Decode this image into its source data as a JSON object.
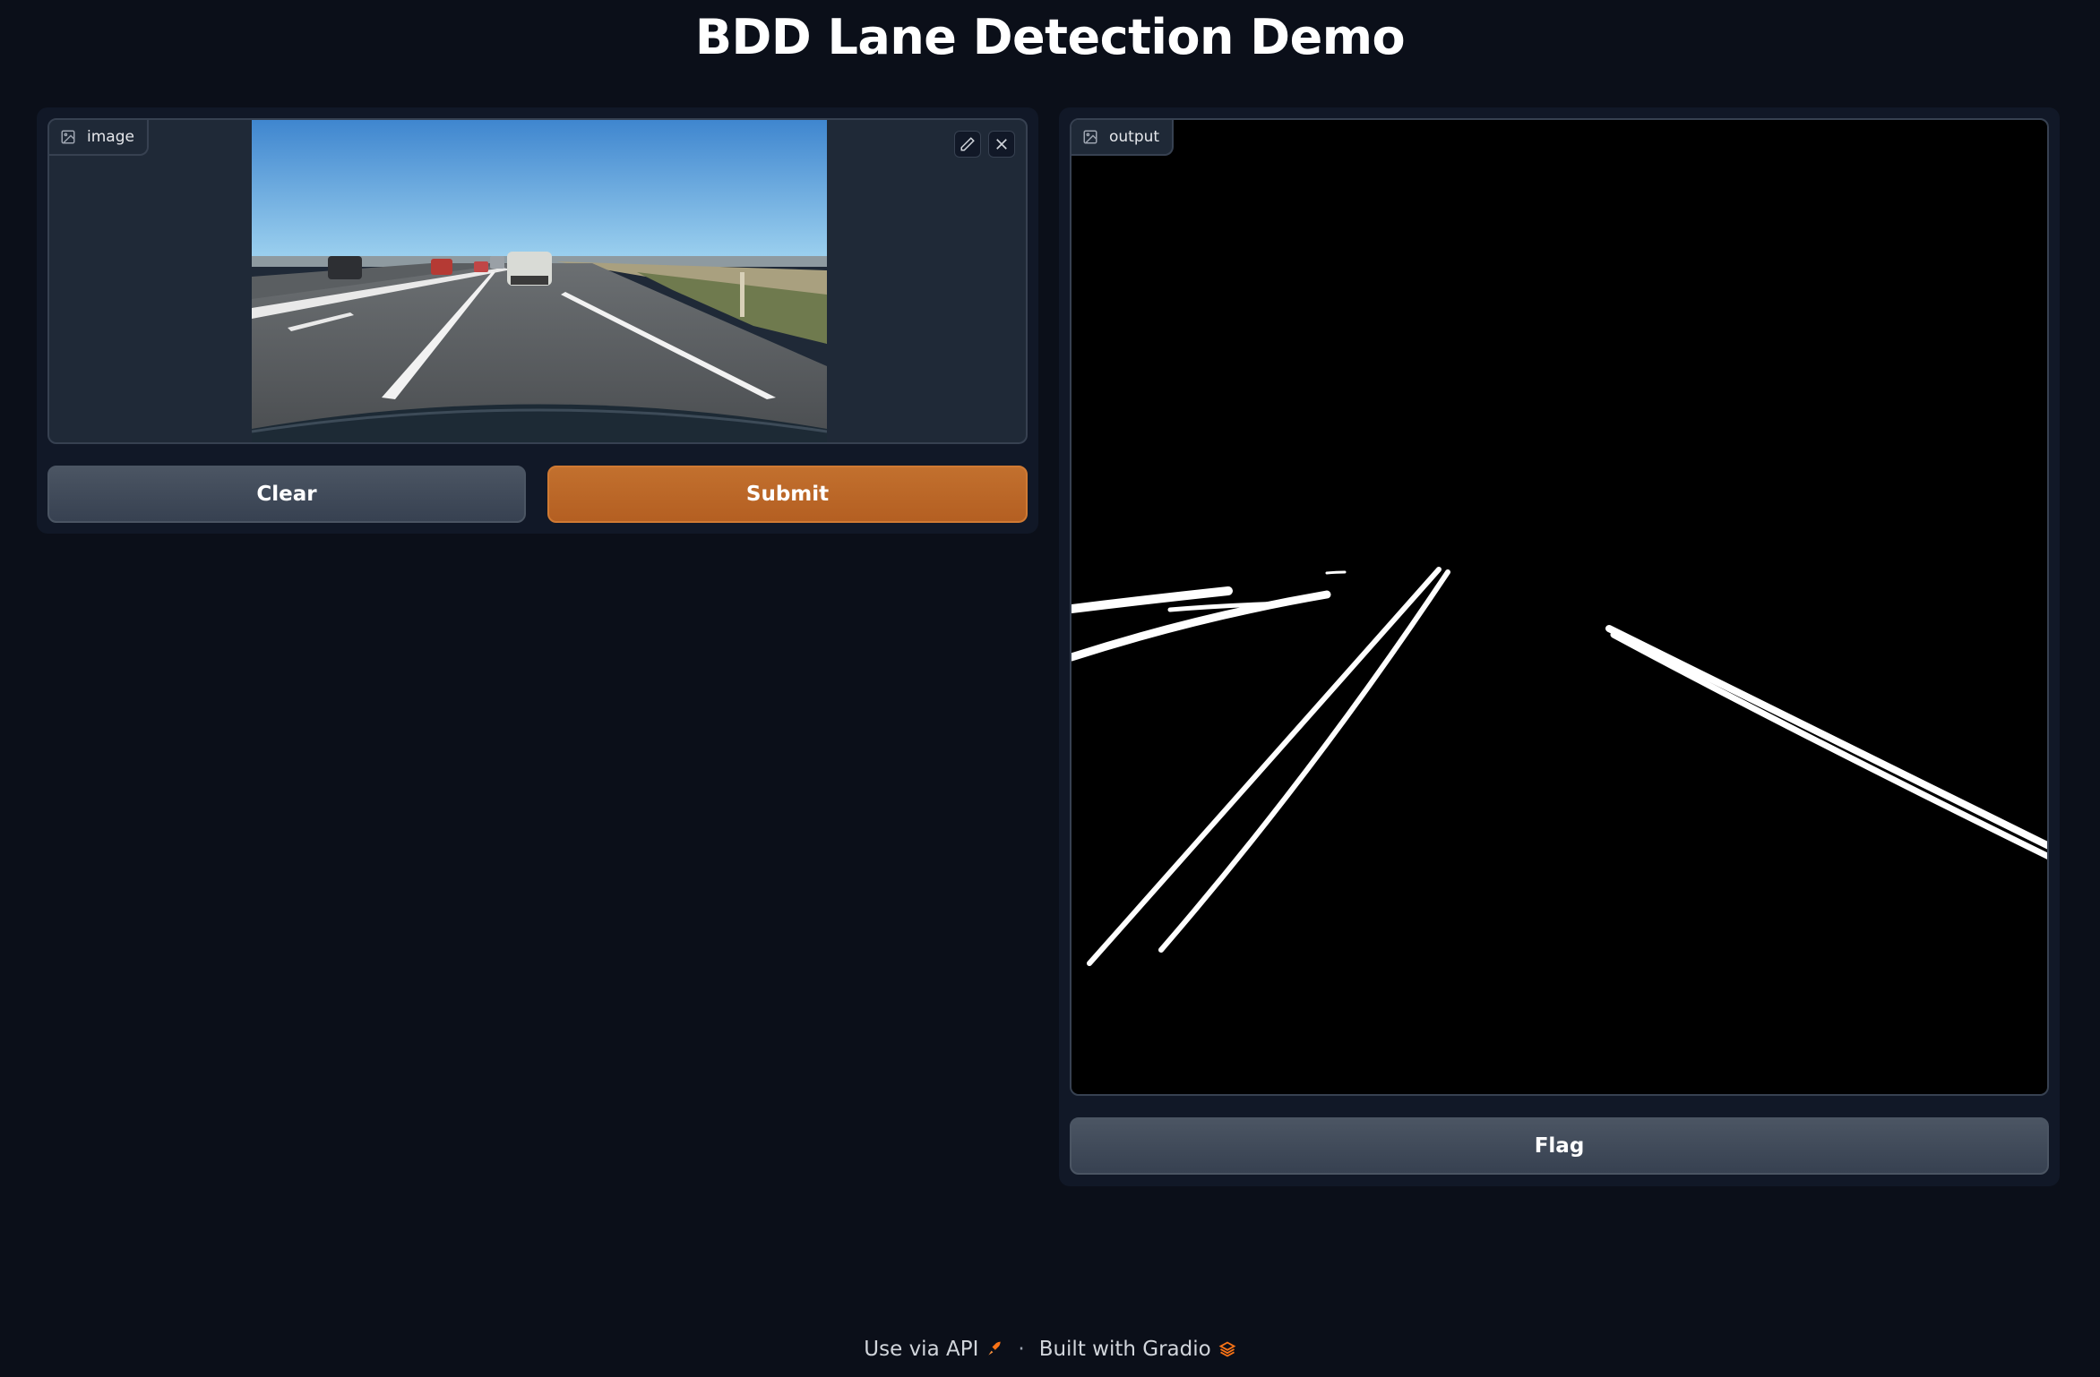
{
  "app": {
    "title": "BDD Lane Detection Demo"
  },
  "input": {
    "label": "image"
  },
  "output": {
    "label": "output"
  },
  "buttons": {
    "clear": "Clear",
    "submit": "Submit",
    "flag": "Flag"
  },
  "footer": {
    "api": "Use via API",
    "separator": "·",
    "built": "Built with Gradio"
  },
  "colors": {
    "primary": "#c2702e",
    "background": "#0b0f19",
    "panel": "#111827"
  },
  "icons": [
    "image-icon",
    "pencil-icon",
    "close-icon",
    "rocket-icon",
    "gradio-logo-icon"
  ]
}
